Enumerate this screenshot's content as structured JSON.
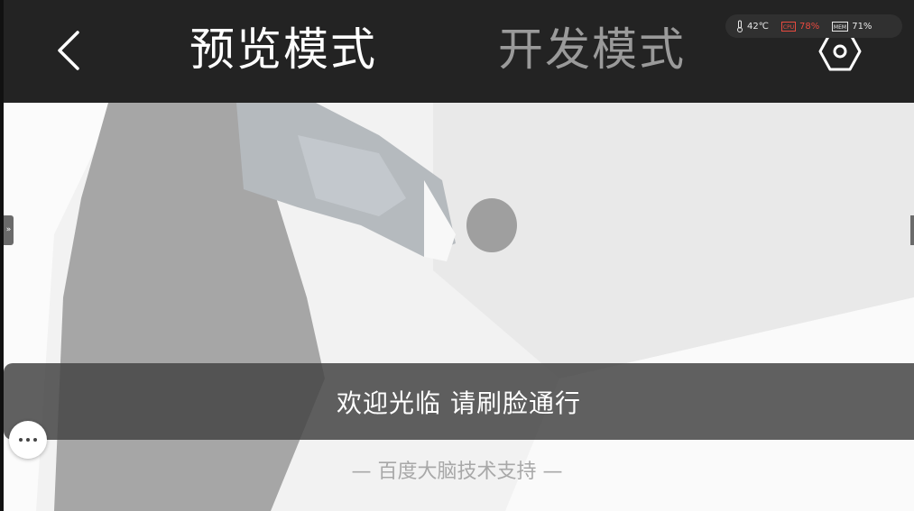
{
  "header": {
    "back_icon": "chevron-left-icon",
    "tabs": [
      {
        "label": "预览模式",
        "active": true
      },
      {
        "label": "开发模式",
        "active": false
      }
    ],
    "settings_icon": "hexagon-settings-icon"
  },
  "status": {
    "temperature": "42℃",
    "cpu_label": "CPU",
    "cpu": "78%",
    "mem_label": "MEM",
    "mem": "71%"
  },
  "side_handle": {
    "label": "»"
  },
  "banner": {
    "text": "欢迎光临 请刷脸通行"
  },
  "footer": {
    "credit": "— 百度大脑技术支持 —"
  },
  "more_button": {
    "icon": "more-dots-icon"
  },
  "colors": {
    "topbar": "#232323",
    "active_tab": "#ffffff",
    "active_underline": "#1d74b8",
    "inactive_tab": "#9a9a9a",
    "cpu_alert": "#e84a3f",
    "banner_bg": "#464646"
  }
}
